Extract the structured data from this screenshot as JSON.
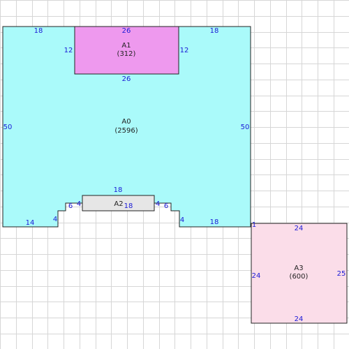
{
  "colors": {
    "grid": "#d6d6d6",
    "outline": "#222222",
    "dimension_text": "#1a1ad6",
    "label_text": "#222222"
  },
  "regions": [
    {
      "id": "A0",
      "name": "A0",
      "area": "(2596)",
      "fill": "#aafafa"
    },
    {
      "id": "A1",
      "name": "A1",
      "area": "(312)",
      "fill": "#ee99ee"
    },
    {
      "id": "A2",
      "name": "A2",
      "area": "",
      "fill": "#e6e6e6"
    },
    {
      "id": "A3",
      "name": "A3",
      "area": "(600)",
      "fill": "#fbdde9"
    }
  ],
  "dimensions": {
    "a0_top_left": "18",
    "a0_top_right": "18",
    "a0_left": "50",
    "a0_right": "50",
    "a0_bottom_left": "14",
    "a0_left_step": "4",
    "a0_notch_left": "6",
    "a0_notch_left_step": "4",
    "a0_notch_right_step": "4",
    "a0_notch_right": "6",
    "a0_right_step": "4",
    "a0_bottom_right": "18",
    "a1_top": "26",
    "a1_left": "12",
    "a1_right": "12",
    "a1_bottom": "26",
    "a2_top": "18",
    "a2_bottom": "18",
    "a3_corner": "1",
    "a3_top": "24",
    "a3_left": "24",
    "a3_right": "25",
    "a3_bottom": "24"
  }
}
